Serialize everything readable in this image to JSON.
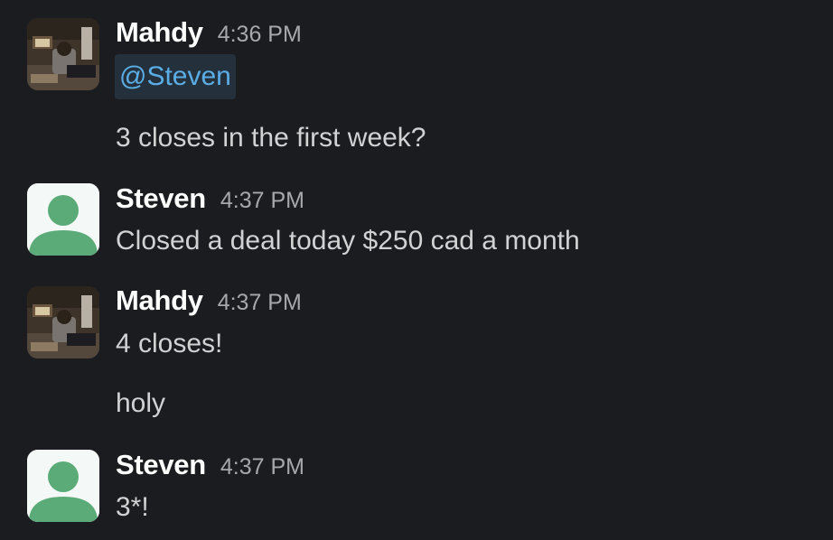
{
  "messages": [
    {
      "author": "Mahdy",
      "time": "4:36 PM",
      "avatar": "photo-avatar",
      "mention": "@Steven",
      "lines": [
        "3 closes in the first week?"
      ]
    },
    {
      "author": "Steven",
      "time": "4:37 PM",
      "avatar": "default-user-icon",
      "lines": [
        "Closed a deal today $250 cad a month"
      ]
    },
    {
      "author": "Mahdy",
      "time": "4:37 PM",
      "avatar": "photo-avatar",
      "lines": [
        "4 closes!",
        "holy"
      ]
    },
    {
      "author": "Steven",
      "time": "4:37 PM",
      "avatar": "default-user-icon",
      "lines": [
        "3*!"
      ]
    }
  ],
  "colors": {
    "background": "#1b1c20",
    "name": "#ffffff",
    "timestamp": "#a8a8ab",
    "text": "#d1d2d3",
    "mention_text": "#5aaee5",
    "mention_bg": "#24313d",
    "default_avatar_bg": "#f4f8f6",
    "default_avatar_fg": "#5bab78"
  }
}
